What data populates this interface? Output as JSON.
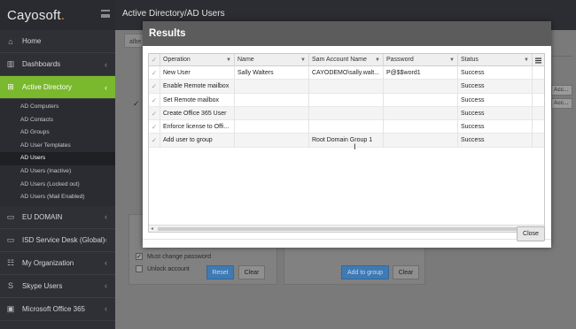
{
  "app": {
    "logo": "Cayosoft",
    "logo_dot": ".",
    "page_title": "Active Directory/AD Users"
  },
  "sidebar": {
    "items": [
      {
        "label": "Home",
        "icon": "home-icon",
        "chevron": ""
      },
      {
        "label": "Dashboards",
        "icon": "bar-chart-icon",
        "chevron": "‹"
      },
      {
        "label": "Active Directory",
        "icon": "sitemap-icon",
        "chevron": "‹",
        "active": true
      }
    ],
    "sub_items": [
      "AD Computers",
      "AD Contacts",
      "AD Groups",
      "AD User Templates",
      "AD Users",
      "AD Users (Inactive)",
      "AD Users (Locked out)",
      "AD Users (Mail Enabled)"
    ],
    "current_sub": "AD Users",
    "bottom_items": [
      {
        "label": "EU DOMAIN",
        "icon": "monitor-icon",
        "chevron": "‹"
      },
      {
        "label": "ISD Service Desk (Global)",
        "icon": "monitor-icon",
        "chevron": "‹"
      },
      {
        "label": "My Organization",
        "icon": "users-icon",
        "chevron": "‹"
      },
      {
        "label": "Skype Users",
        "icon": "skype-icon",
        "chevron": "‹"
      },
      {
        "label": "Microsoft Office 365",
        "icon": "office-icon",
        "chevron": "‹"
      }
    ]
  },
  "background": {
    "tag": "albe",
    "options": {
      "must_change_password": "Must change password",
      "unlock_account": "Unlock account"
    },
    "reset_label": "Reset",
    "clear_label_1": "Clear",
    "add_to_group_label": "Add to group",
    "clear_label_2": "Clear",
    "acc_label": "Acc..."
  },
  "modal": {
    "title": "Results",
    "columns": [
      "Operation",
      "Name",
      "Sam Account Name",
      "Password",
      "Status"
    ],
    "rows": [
      {
        "operation": "New User",
        "name": "Sally Walters",
        "sam": "CAYODEMO\\sally.walt...",
        "password": "P@$$word1",
        "status": "Success"
      },
      {
        "operation": "Enable Remote mailbox",
        "name": "",
        "sam": "",
        "password": "",
        "status": "Success"
      },
      {
        "operation": "Set Remote mailbox",
        "name": "",
        "sam": "",
        "password": "",
        "status": "Success"
      },
      {
        "operation": "Create Office 365 User",
        "name": "",
        "sam": "",
        "password": "",
        "status": "Success"
      },
      {
        "operation": "Enforce license to Offi...",
        "name": "",
        "sam": "",
        "password": "",
        "status": "Success"
      },
      {
        "operation": "Add user to group",
        "name": "",
        "sam": "Root Domain Group 1",
        "password": "",
        "status": "Success"
      }
    ],
    "close_label": "Close"
  }
}
